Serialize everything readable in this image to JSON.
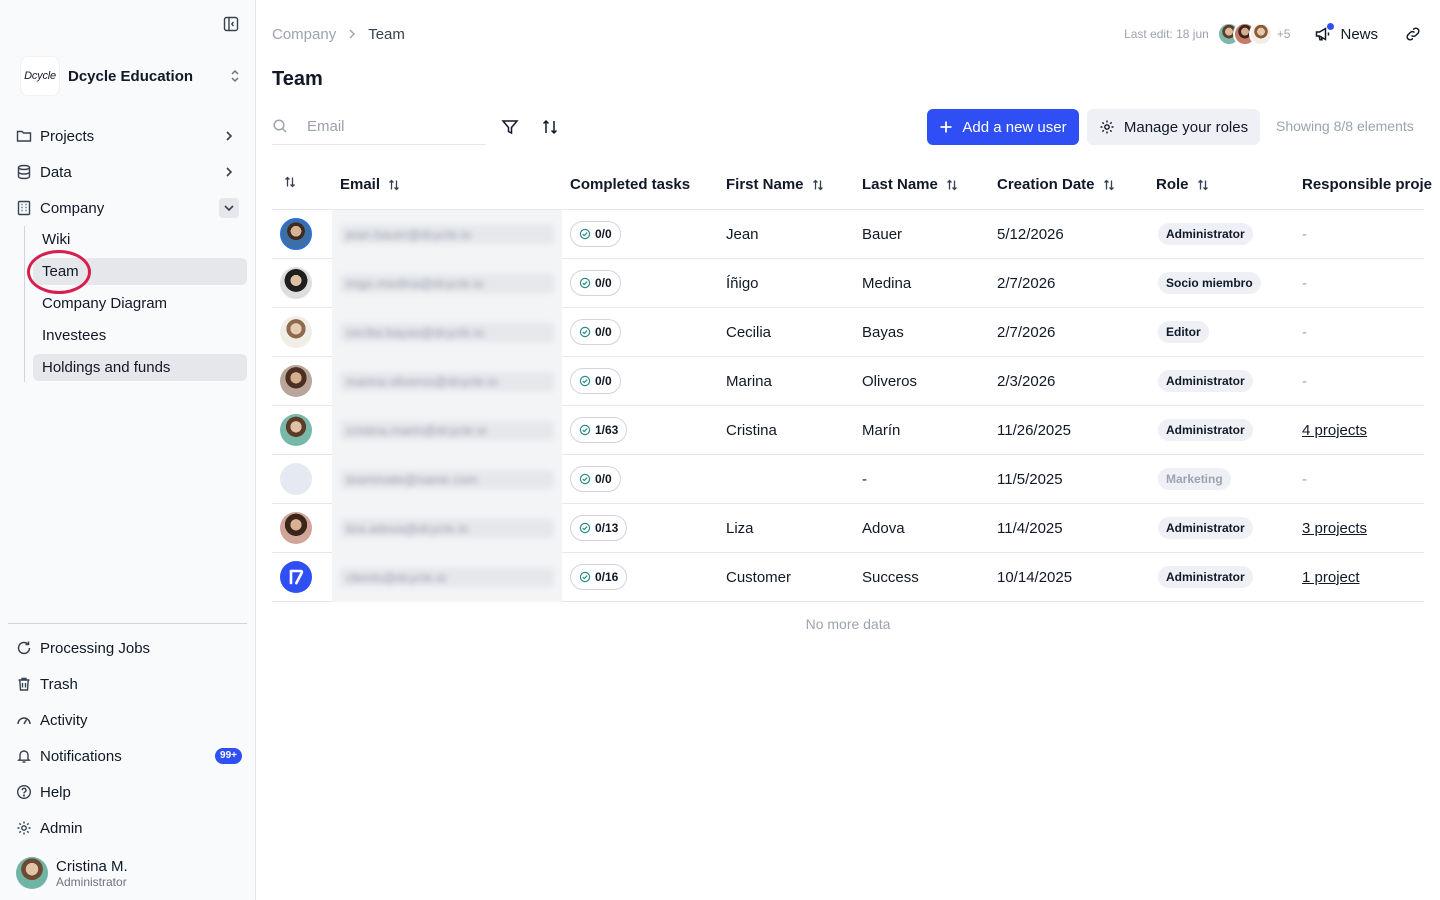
{
  "org": {
    "logo_text": "Dcycle",
    "name": "Dcycle Education"
  },
  "sidebar": {
    "top_items": [
      {
        "label": "Projects",
        "icon": "folder-icon"
      },
      {
        "label": "Data",
        "icon": "database-icon"
      },
      {
        "label": "Company",
        "icon": "building-icon"
      }
    ],
    "company_sub": [
      "Wiki",
      "Team",
      "Company Diagram",
      "Investees",
      "Holdings and funds"
    ],
    "active_sub": "Team",
    "bottom_items": [
      {
        "label": "Processing Jobs",
        "icon": "refresh-icon"
      },
      {
        "label": "Trash",
        "icon": "trash-icon"
      },
      {
        "label": "Activity",
        "icon": "gauge-icon"
      },
      {
        "label": "Notifications",
        "icon": "bell-icon",
        "badge": "99+"
      },
      {
        "label": "Help",
        "icon": "help-circle-icon"
      },
      {
        "label": "Admin",
        "icon": "gear-icon"
      }
    ],
    "user": {
      "name": "Cristina M.",
      "role": "Administrator"
    }
  },
  "header": {
    "breadcrumb": {
      "parent": "Company",
      "current": "Team"
    },
    "last_edit": "Last edit: 18 jun",
    "more_editors": "+5",
    "news_label": "News"
  },
  "page": {
    "title": "Team"
  },
  "toolbar": {
    "search_placeholder": "Email",
    "add_user_label": "Add a new user",
    "manage_roles_label": "Manage your roles",
    "showing_text": "Showing 8/8 elements"
  },
  "table": {
    "columns": {
      "email": "Email",
      "completed_tasks": "Completed tasks",
      "first_name": "First Name",
      "last_name": "Last Name",
      "creation_date": "Creation Date",
      "role": "Role",
      "responsible_projects": "Responsible proje"
    },
    "rows": [
      {
        "avatar": "photo-man-1",
        "email": "jean.bauer@dcycle.io",
        "tasks": "0/0",
        "first_name": "Jean",
        "last_name": "Bauer",
        "date": "5/12/2026",
        "role": "Administrator",
        "projects": "-"
      },
      {
        "avatar": "photo-man-2",
        "email": "inigo.medina@dcycle.io",
        "tasks": "0/0",
        "first_name": "Íñigo",
        "last_name": "Medina",
        "date": "2/7/2026",
        "role": "Socio miembro",
        "projects": "-"
      },
      {
        "avatar": "photo-woman-1",
        "email": "cecilia.bayas@dcycle.io",
        "tasks": "0/0",
        "first_name": "Cecilia",
        "last_name": "Bayas",
        "date": "2/7/2026",
        "role": "Editor",
        "projects": "-"
      },
      {
        "avatar": "photo-woman-2",
        "email": "marina.oliveros@dcycle.io",
        "tasks": "0/0",
        "first_name": "Marina",
        "last_name": "Oliveros",
        "date": "2/3/2026",
        "role": "Administrator",
        "projects": "-"
      },
      {
        "avatar": "photo-woman-3",
        "email": "cristina.marin@dcycle.io",
        "tasks": "1/63",
        "first_name": "Cristina",
        "last_name": "Marín",
        "date": "11/26/2025",
        "role": "Administrator",
        "projects": "4 projects"
      },
      {
        "avatar": "empty",
        "email": "teammate@name.com",
        "tasks": "0/0",
        "first_name": "",
        "last_name": "-",
        "date": "11/5/2025",
        "role": "Marketing",
        "role_muted": true,
        "projects": "-"
      },
      {
        "avatar": "photo-woman-4",
        "email": "liza.adova@dcycle.io",
        "tasks": "0/13",
        "first_name": "Liza",
        "last_name": "Adova",
        "date": "11/4/2025",
        "role": "Administrator",
        "projects": "3 projects"
      },
      {
        "avatar": "dcycle-logo",
        "email": "clients@dcycle.io",
        "tasks": "0/16",
        "first_name": "Customer",
        "last_name": "Success",
        "date": "10/14/2025",
        "role": "Administrator",
        "projects": "1 project"
      }
    ],
    "footer": "No more data"
  },
  "colors": {
    "accent": "#2f4ff5",
    "highlight_ring": "#d61f4e",
    "badge_bg": "#eef0f5"
  }
}
